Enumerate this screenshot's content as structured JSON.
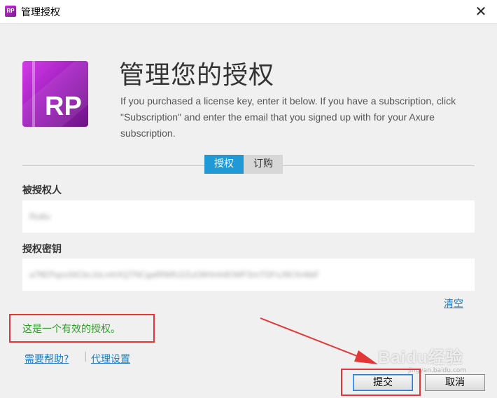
{
  "window": {
    "title": "管理授权",
    "app_icon_text": "RP",
    "close_glyph": "✕"
  },
  "logo": {
    "text": "RP"
  },
  "header": {
    "title": "管理您的授权",
    "description": "If you purchased a license key, enter it below. If you have a subscription, click \"Subscription\" and enter the email that you signed up with for your Axure subscription."
  },
  "tabs": [
    {
      "label": "授权",
      "active": true
    },
    {
      "label": "订购",
      "active": false
    }
  ],
  "fields": {
    "licensee_label": "被授权人",
    "licensee_value": "Ruiliu",
    "key_label": "授权密钥",
    "key_value": "a7ftEPqzc0IiCbcJoLmhXQTNCgaRfWfU2ZuO8HmhIEIWFSmTDFsJ9C0r4tbF"
  },
  "clear_label": "清空",
  "status": {
    "message": "这是一个有效的授权。"
  },
  "links": {
    "help": "需要帮助?",
    "separator": "|",
    "proxy": "代理设置"
  },
  "buttons": {
    "submit": "提交",
    "cancel": "取消"
  },
  "watermark": {
    "text": "Baidu经验",
    "sub": "jingyan.baidu.com"
  },
  "colors": {
    "accent_tab": "#1f9ad6",
    "link": "#1a7fc7",
    "valid_status": "#2f9e28",
    "annotation_red": "#e33636",
    "brand_purple": "#a421c1"
  }
}
